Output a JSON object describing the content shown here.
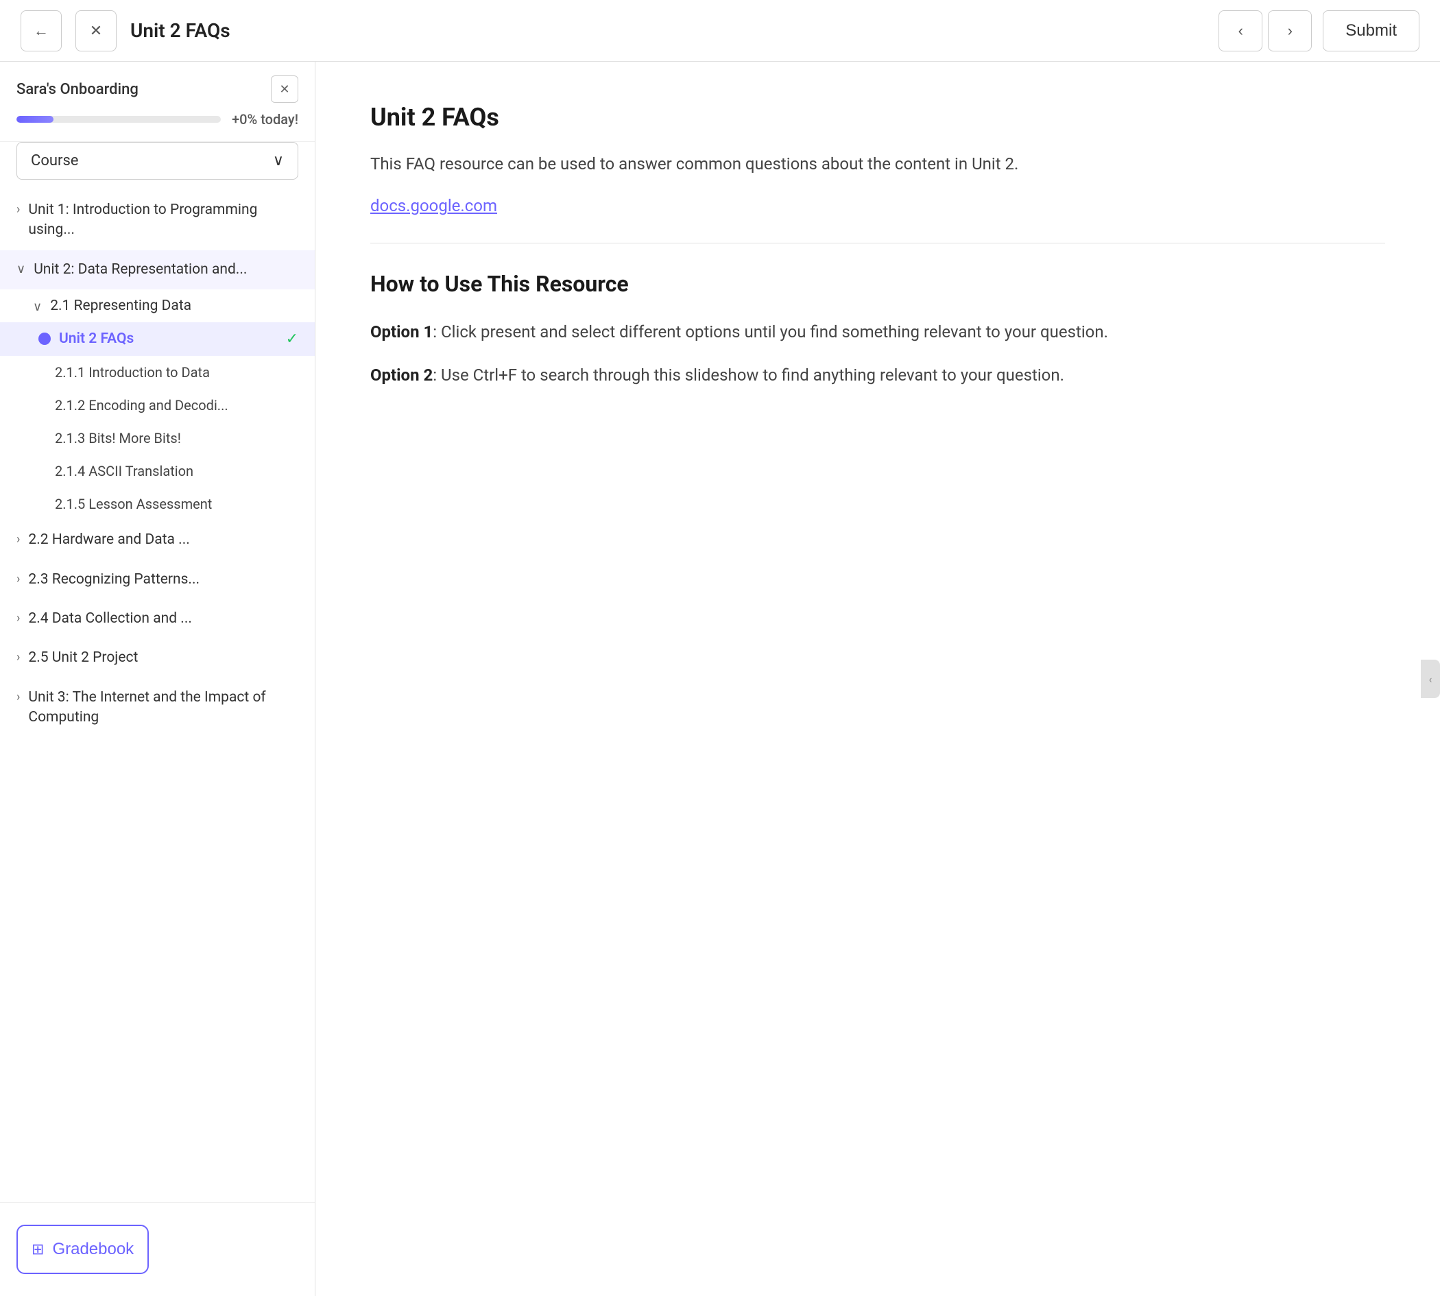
{
  "header": {
    "back_label": "←",
    "close_label": "✕",
    "title": "Unit 2 FAQs",
    "prev_label": "‹",
    "next_label": "›",
    "submit_label": "Submit"
  },
  "sidebar": {
    "onboarding": {
      "title": "Sara's Onboarding",
      "close_label": "✕",
      "progress_label": "+0% today!",
      "progress_percent": 18
    },
    "course_dropdown": {
      "label": "Course",
      "chevron": "∨"
    },
    "nav": {
      "unit1": {
        "label": "Unit 1: Introduction to Programming using...",
        "chevron": "›"
      },
      "unit2": {
        "label": "Unit 2: Data Representation and...",
        "chevron": "∨",
        "expanded": true
      },
      "section21": {
        "label": "2.1 Representing Data",
        "chevron": "∨"
      },
      "active_item": {
        "label": "Unit 2 FAQs"
      },
      "lessons": [
        {
          "label": "2.1.1 Introduction to Data"
        },
        {
          "label": "2.1.2 Encoding and Decodi..."
        },
        {
          "label": "2.1.3 Bits! More Bits!"
        },
        {
          "label": "2.1.4 ASCII Translation"
        },
        {
          "label": "2.1.5 Lesson Assessment"
        }
      ],
      "section22": {
        "label": "2.2 Hardware and Data ...",
        "chevron": "›"
      },
      "section23": {
        "label": "2.3 Recognizing Patterns...",
        "chevron": "›"
      },
      "section24": {
        "label": "2.4 Data Collection and ...",
        "chevron": "›"
      },
      "section25": {
        "label": "2.5 Unit 2 Project",
        "chevron": "›"
      },
      "unit3": {
        "label": "Unit 3: The Internet and the Impact of Computing",
        "chevron": "›"
      }
    },
    "gradebook": {
      "label": "Gradebook",
      "icon": "📊"
    }
  },
  "content": {
    "title": "Unit 2 FAQs",
    "description": "This FAQ resource can be used to answer common questions about the content in Unit 2.",
    "link_text": "docs.google.com",
    "section_title": "How to Use This Resource",
    "option1_strong": "Option 1",
    "option1_text": ": Click present and select different options until you find something relevant to your question.",
    "option2_strong": "Option 2",
    "option2_text": ": Use Ctrl+F to search through this slideshow to find anything relevant to your question."
  }
}
